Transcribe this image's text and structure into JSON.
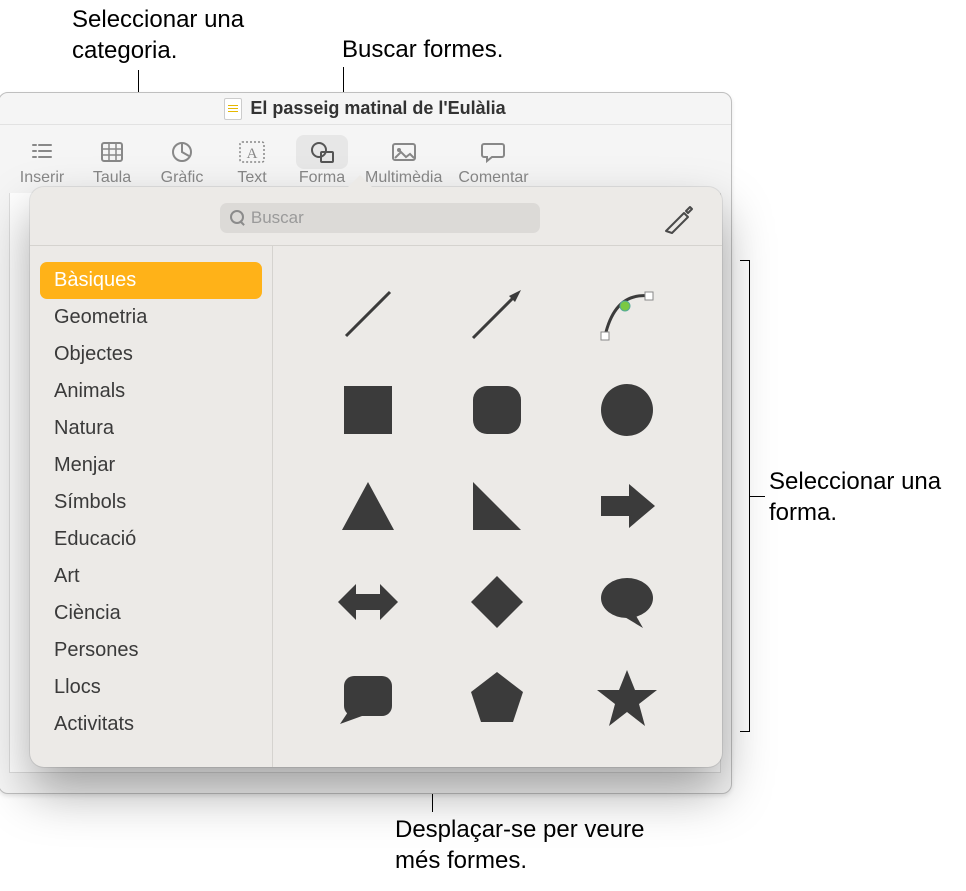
{
  "callouts": {
    "select_category": "Seleccionar una categoria.",
    "search_shapes": "Buscar formes.",
    "select_shape": "Seleccionar una forma.",
    "scroll_more": "Desplaçar-se per veure més formes."
  },
  "document": {
    "title": "El passeig matinal de l'Eulàlia"
  },
  "toolbar": [
    {
      "key": "inserir",
      "label": "Inserir",
      "glyph": "≣"
    },
    {
      "key": "taula",
      "label": "Taula",
      "glyph": "▦"
    },
    {
      "key": "grafic",
      "label": "Gràfic",
      "glyph": "◔"
    },
    {
      "key": "text",
      "label": "Text",
      "glyph": "A"
    },
    {
      "key": "forma",
      "label": "Forma",
      "glyph": "◯△",
      "active": true
    },
    {
      "key": "multimedia",
      "label": "Multimèdia",
      "glyph": "🖼"
    },
    {
      "key": "comentar",
      "label": "Comentar",
      "glyph": "💬"
    }
  ],
  "search": {
    "placeholder": "Buscar"
  },
  "categories": [
    {
      "label": "Bàsiques",
      "active": true
    },
    {
      "label": "Geometria"
    },
    {
      "label": "Objectes"
    },
    {
      "label": "Animals"
    },
    {
      "label": "Natura"
    },
    {
      "label": "Menjar"
    },
    {
      "label": "Símbols"
    },
    {
      "label": "Educació"
    },
    {
      "label": "Art"
    },
    {
      "label": "Ciència"
    },
    {
      "label": "Persones"
    },
    {
      "label": "Llocs"
    },
    {
      "label": "Activitats"
    }
  ],
  "shapes": [
    "line",
    "arrow-line",
    "curve",
    "square",
    "rounded-square",
    "circle",
    "triangle",
    "right-triangle",
    "arrow-right",
    "double-arrow",
    "diamond",
    "speech-bubble",
    "callout-box",
    "pentagon",
    "star"
  ],
  "shape_fill": "#3b3b3b"
}
